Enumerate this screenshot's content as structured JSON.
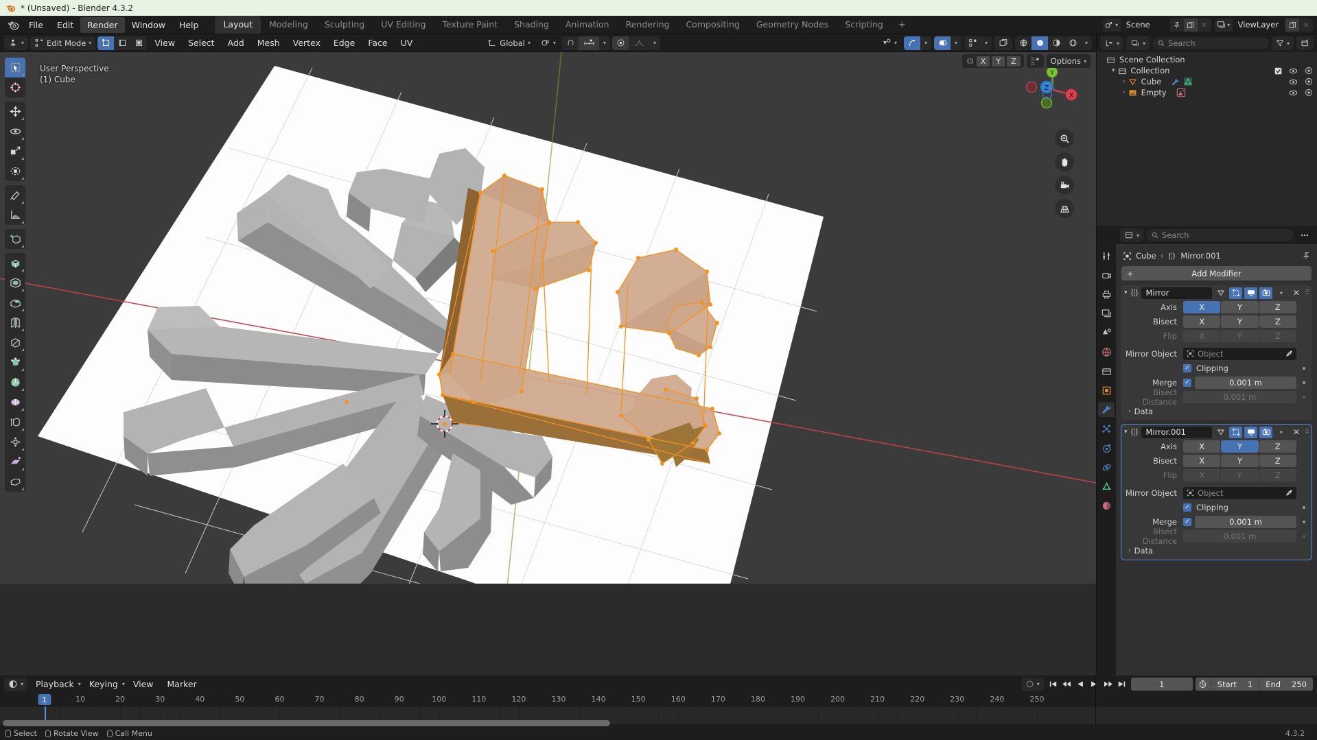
{
  "window": {
    "title": "* (Unsaved) - Blender 4.3.2"
  },
  "topbar": {
    "menus": [
      {
        "label": "File",
        "active": false
      },
      {
        "label": "Edit",
        "active": false
      },
      {
        "label": "Render",
        "active": true
      },
      {
        "label": "Window",
        "active": false
      },
      {
        "label": "Help",
        "active": false
      }
    ],
    "workspaces": [
      {
        "label": "Layout",
        "active": true
      },
      {
        "label": "Modeling",
        "active": false
      },
      {
        "label": "Sculpting",
        "active": false
      },
      {
        "label": "UV Editing",
        "active": false
      },
      {
        "label": "Texture Paint",
        "active": false
      },
      {
        "label": "Shading",
        "active": false
      },
      {
        "label": "Animation",
        "active": false
      },
      {
        "label": "Rendering",
        "active": false
      },
      {
        "label": "Compositing",
        "active": false
      },
      {
        "label": "Geometry Nodes",
        "active": false
      },
      {
        "label": "Scripting",
        "active": false
      }
    ],
    "add_workspace": "+",
    "scene": {
      "name": "Scene",
      "icon": "scene-icon"
    },
    "viewlayer": {
      "name": "ViewLayer",
      "icon": "viewlayer-icon"
    }
  },
  "viewport": {
    "mode": "Edit Mode",
    "menus": [
      "View",
      "Select",
      "Add",
      "Mesh",
      "Vertex",
      "Edge",
      "Face",
      "UV"
    ],
    "transform_orientation": "Global",
    "options_label": "Options",
    "overlay": {
      "line1": "User Perspective",
      "line2": "(1) Cube"
    },
    "mirror_axes": [
      "X",
      "Y",
      "Z"
    ],
    "gizmo_axes": {
      "x": "X",
      "y": "Y",
      "z": "Z"
    },
    "select_modes": [
      "vertex-select",
      "edge-select",
      "face-select"
    ],
    "tools": [
      "tweak-tool",
      "cursor-tool",
      "move-tool",
      "rotate-tool",
      "scale-tool",
      "transform-tool",
      "measure-tool",
      "annotate-tool",
      "add-cube-tool",
      "extrude-region-tool",
      "inset-faces-tool",
      "bevel-tool",
      "loop-cut-tool",
      "knife-tool",
      "poly-build-tool",
      "spin-tool",
      "smooth-tool",
      "edge-slide-tool",
      "shrink-fatten-tool",
      "shear-tool",
      "rip-region-tool"
    ]
  },
  "outliner": {
    "search_placeholder": "Search",
    "rows": [
      {
        "label": "Scene Collection",
        "icon": "collection-icon",
        "depth": 0,
        "expand": "",
        "checkbox": false,
        "eye": false,
        "camera": false
      },
      {
        "label": "Collection",
        "icon": "collection-icon",
        "depth": 1,
        "expand": "v",
        "checkbox": true,
        "eye": true,
        "camera": true
      },
      {
        "label": "Cube",
        "icon": "mesh-object-icon",
        "depth": 2,
        "expand": ">",
        "checkbox": false,
        "eye": true,
        "camera": true,
        "badges": [
          "modifier-wrench-icon",
          "mesh-data-icon"
        ]
      },
      {
        "label": "Empty",
        "icon": "empty-image-object-icon",
        "depth": 2,
        "expand": ">",
        "checkbox": false,
        "eye": true,
        "camera": true,
        "badges": [
          "empty-image-data-icon"
        ]
      }
    ]
  },
  "properties": {
    "search_placeholder": "Search",
    "breadcrumb": {
      "object": "Cube",
      "modifier": "Mirror.001"
    },
    "add_modifier_label": "Add Modifier",
    "tabs": [
      "tool-icon",
      "render-icon",
      "output-icon",
      "view-layer-icon",
      "scene-icon",
      "world-icon",
      "collection-icon",
      "object-icon",
      "modifier-icon",
      "particles-icon",
      "physics-icon",
      "constraints-icon",
      "data-icon",
      "material-icon"
    ],
    "active_tab": "modifier-icon",
    "modifiers": [
      {
        "name": "Mirror",
        "selected": false,
        "header_toggles": [
          {
            "name": "on-cage-icon",
            "state": "off"
          },
          {
            "name": "edit-mode-icon",
            "state": "on"
          },
          {
            "name": "realtime-icon",
            "state": "on"
          },
          {
            "name": "render-icon",
            "state": "on"
          }
        ],
        "axis": {
          "label": "Axis",
          "options": [
            "X",
            "Y",
            "Z"
          ],
          "active": [
            "X"
          ]
        },
        "bisect": {
          "label": "Bisect",
          "options": [
            "X",
            "Y",
            "Z"
          ],
          "active": []
        },
        "flip": {
          "label": "Flip",
          "options": [
            "X",
            "Y",
            "Z"
          ],
          "active": [],
          "disabled": true
        },
        "mirror_object": {
          "label": "Mirror Object",
          "placeholder": "Object",
          "value": ""
        },
        "clipping": {
          "label": "Clipping",
          "checked": true
        },
        "merge": {
          "label": "Merge",
          "checked": true,
          "value": "0.001 m"
        },
        "bisect_distance": {
          "label": "Bisect Distance",
          "value": "0.001 m",
          "disabled": true
        },
        "data_label": "Data"
      },
      {
        "name": "Mirror.001",
        "selected": true,
        "header_toggles": [
          {
            "name": "on-cage-icon",
            "state": "off"
          },
          {
            "name": "edit-mode-icon",
            "state": "on"
          },
          {
            "name": "realtime-icon",
            "state": "on"
          },
          {
            "name": "render-icon",
            "state": "on"
          }
        ],
        "axis": {
          "label": "Axis",
          "options": [
            "X",
            "Y",
            "Z"
          ],
          "active": [
            "Y"
          ]
        },
        "bisect": {
          "label": "Bisect",
          "options": [
            "X",
            "Y",
            "Z"
          ],
          "active": []
        },
        "flip": {
          "label": "Flip",
          "options": [
            "X",
            "Y",
            "Z"
          ],
          "active": [],
          "disabled": true
        },
        "mirror_object": {
          "label": "Mirror Object",
          "placeholder": "Object",
          "value": ""
        },
        "clipping": {
          "label": "Clipping",
          "checked": true
        },
        "merge": {
          "label": "Merge",
          "checked": true,
          "value": "0.001 m"
        },
        "bisect_distance": {
          "label": "Bisect Distance",
          "value": "0.001 m",
          "disabled": true
        },
        "data_label": "Data"
      }
    ]
  },
  "timeline": {
    "menus": [
      "Playback",
      "Keying",
      "View",
      "Marker"
    ],
    "current_frame": "1",
    "start_label": "Start",
    "start_value": "1",
    "end_label": "End",
    "end_value": "250",
    "ticks": [
      10,
      20,
      30,
      40,
      50,
      60,
      70,
      80,
      90,
      100,
      110,
      120,
      130,
      140,
      150,
      160,
      170,
      180,
      190,
      200,
      210,
      220,
      230,
      240,
      250
    ],
    "playhead_frame": 1
  },
  "statusbar": {
    "items": [
      {
        "icon": "mouse-left-icon",
        "label": "Select"
      },
      {
        "icon": "mouse-middle-icon",
        "label": "Rotate View"
      },
      {
        "icon": "mouse-right-icon",
        "label": "Call Menu"
      }
    ],
    "version": "4.3.2"
  },
  "colors": {
    "accent_blue": "#4772b3",
    "selection_orange": "#ed9a1f",
    "panel_bg": "#303030",
    "header_bg": "#1d1d1d"
  }
}
